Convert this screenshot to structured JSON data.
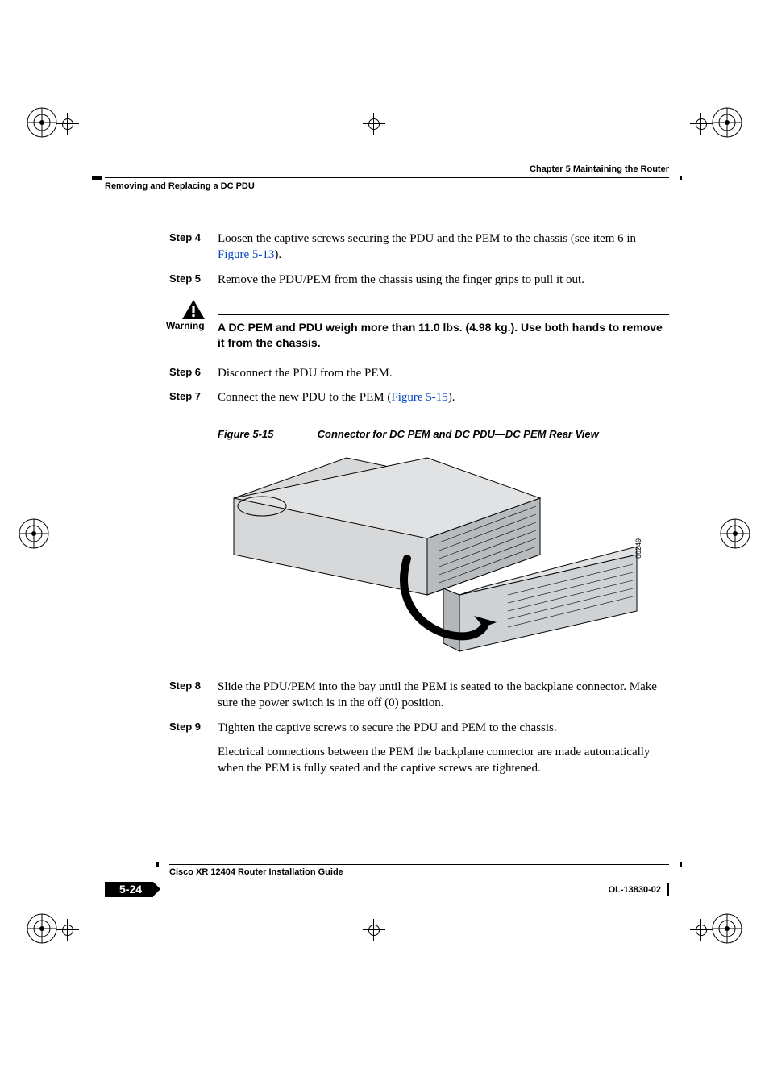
{
  "header": {
    "chapter_line": "Chapter 5      Maintaining the Router",
    "section_title": "Removing and Replacing a DC PDU"
  },
  "steps_block_a": [
    {
      "label": "Step 4",
      "text_pre": "Loosen the captive screws securing the PDU and the PEM to the chassis (see item 6 in ",
      "xref": "Figure 5-13",
      "text_post": ")."
    },
    {
      "label": "Step 5",
      "text_pre": "Remove the PDU/PEM from the chassis using the finger grips to pull it out.",
      "xref": "",
      "text_post": ""
    }
  ],
  "warning": {
    "label": "Warning",
    "text": "A DC PEM and PDU weigh more than 11.0 lbs. (4.98 kg.). Use both hands to remove it from the chassis."
  },
  "steps_block_b": [
    {
      "label": "Step 6",
      "text_pre": "Disconnect the PDU from the PEM.",
      "xref": "",
      "text_post": ""
    },
    {
      "label": "Step 7",
      "text_pre": "Connect the new PDU to the PEM (",
      "xref": "Figure 5-15",
      "text_post": ")."
    }
  ],
  "figure": {
    "number": "Figure 5-15",
    "caption": "Connector for DC PEM and DC PDU—DC PEM Rear View",
    "artwork_id": "66249"
  },
  "steps_block_c": [
    {
      "label": "Step 8",
      "text_pre": "Slide the PDU/PEM into the bay until the PEM is seated to the backplane connector. Make sure the power switch is in the off (0) position.",
      "xref": "",
      "text_post": ""
    },
    {
      "label": "Step 9",
      "text_pre": "Tighten the captive screws to secure the PDU and PEM to the chassis.",
      "xref": "",
      "text_post": ""
    }
  ],
  "trailing_para": "Electrical connections between the PEM the backplane connector are made automatically when the PEM is fully seated and the captive screws are tightened.",
  "footer": {
    "book_title": "Cisco XR 12404 Router Installation Guide",
    "page_number": "5-24",
    "doc_number": "OL-13830-02"
  }
}
